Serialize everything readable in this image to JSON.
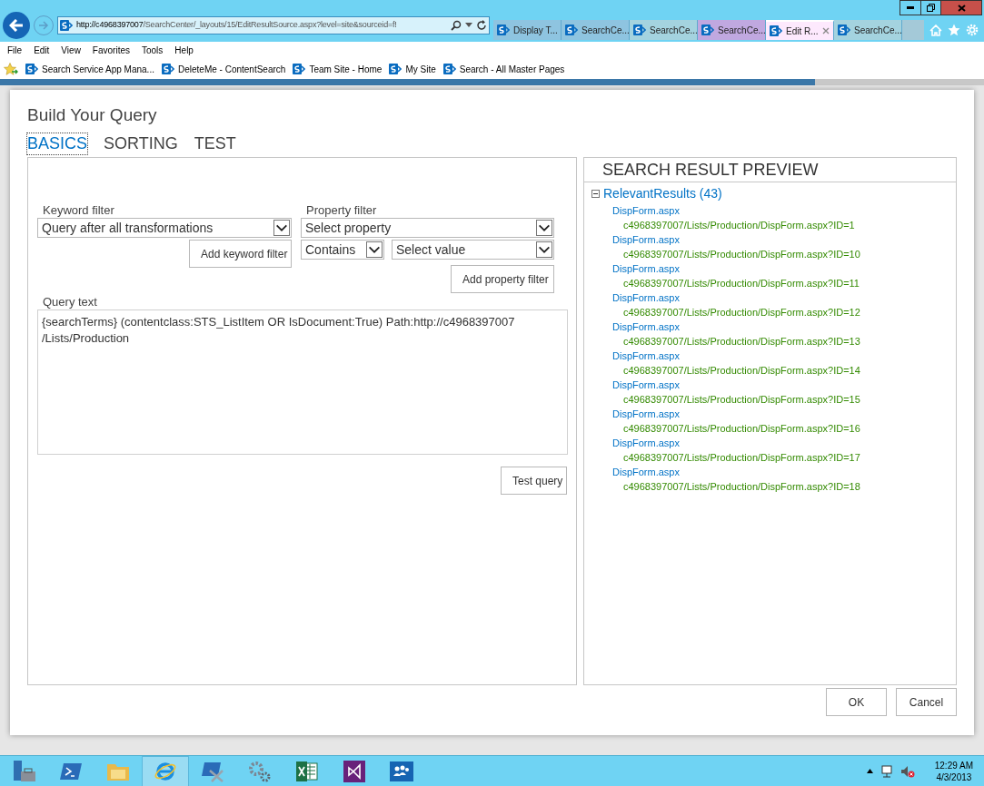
{
  "browser": {
    "address": {
      "host": "http://c4968397007",
      "path": "/SearchCenter/_layouts/15/EditResultSource.aspx?level=site&sourceid=f!"
    },
    "tabs": [
      {
        "label": "Display T...",
        "selected": false,
        "color": "#8ec4e0"
      },
      {
        "label": "SearchCe...",
        "selected": false,
        "color": "#8ec4e0"
      },
      {
        "label": "SearchCe...",
        "selected": false,
        "color": "#a4d3df"
      },
      {
        "label": "SearchCe...",
        "selected": false,
        "color": "#c0a8e0"
      },
      {
        "label": "Edit R...",
        "selected": true,
        "color": "#fde9fd"
      },
      {
        "label": "SearchCe...",
        "selected": false,
        "color": "#a4d3df"
      }
    ],
    "menu": [
      "File",
      "Edit",
      "View",
      "Favorites",
      "Tools",
      "Help"
    ],
    "favorites": [
      "Search Service App Mana...",
      "DeleteMe - ContentSearch",
      "Team Site - Home",
      "My Site",
      "Search - All Master Pages"
    ]
  },
  "dialog": {
    "title": "Build Your Query",
    "tabs": [
      {
        "label": "BASICS",
        "selected": true
      },
      {
        "label": "SORTING",
        "selected": false
      },
      {
        "label": "TEST",
        "selected": false
      }
    ],
    "keyword_filter": {
      "label": "Keyword filter",
      "value": "Query after all transformations",
      "button": "Add keyword filter"
    },
    "property_filter": {
      "label": "Property filter",
      "property": "Select property",
      "operator": "Contains",
      "value": "Select value",
      "button": "Add property filter"
    },
    "query_text": {
      "label": "Query text",
      "value": "{searchTerms} (contentclass:STS_ListItem OR IsDocument:True) Path:http://c4968397007\n/Lists/Production"
    },
    "test_button": "Test query",
    "preview": {
      "title": "SEARCH RESULT PREVIEW",
      "group": "RelevantResults (43)",
      "expanded": true,
      "results": [
        {
          "title": "DispForm.aspx",
          "url": "c4968397007/Lists/Production/DispForm.aspx?ID=1"
        },
        {
          "title": "DispForm.aspx",
          "url": "c4968397007/Lists/Production/DispForm.aspx?ID=10"
        },
        {
          "title": "DispForm.aspx",
          "url": "c4968397007/Lists/Production/DispForm.aspx?ID=11"
        },
        {
          "title": "DispForm.aspx",
          "url": "c4968397007/Lists/Production/DispForm.aspx?ID=12"
        },
        {
          "title": "DispForm.aspx",
          "url": "c4968397007/Lists/Production/DispForm.aspx?ID=13"
        },
        {
          "title": "DispForm.aspx",
          "url": "c4968397007/Lists/Production/DispForm.aspx?ID=14"
        },
        {
          "title": "DispForm.aspx",
          "url": "c4968397007/Lists/Production/DispForm.aspx?ID=15"
        },
        {
          "title": "DispForm.aspx",
          "url": "c4968397007/Lists/Production/DispForm.aspx?ID=16"
        },
        {
          "title": "DispForm.aspx",
          "url": "c4968397007/Lists/Production/DispForm.aspx?ID=17"
        },
        {
          "title": "DispForm.aspx",
          "url": "c4968397007/Lists/Production/DispForm.aspx?ID=18"
        }
      ]
    },
    "buttons": [
      "OK",
      "Cancel"
    ]
  },
  "taskbar": {
    "time": "12:29 AM",
    "date": "4/3/2013"
  }
}
